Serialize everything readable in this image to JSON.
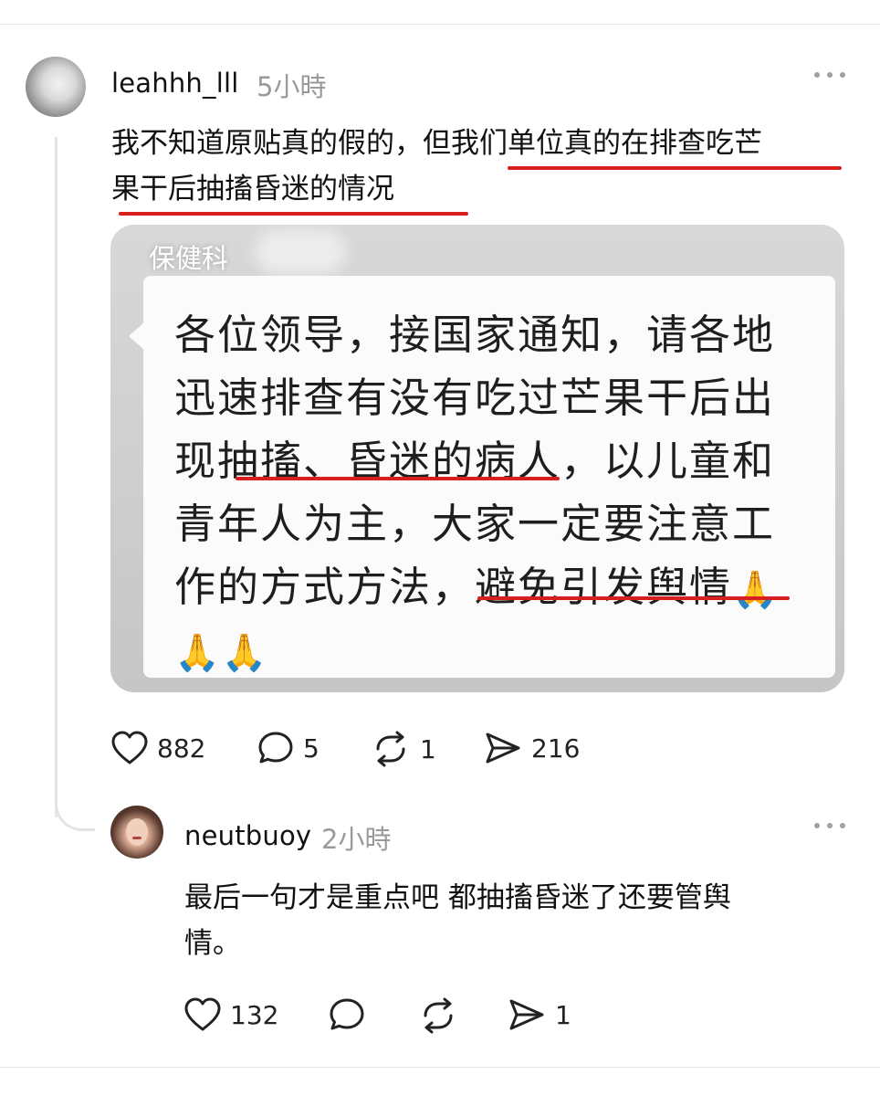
{
  "post": {
    "username": "leahhh_lll",
    "time": "5小時",
    "text_line1": "我不知道原贴真的假的，但我们单位真的在排查吃芒",
    "text_line2": "果干后抽搐昏迷的情况",
    "image": {
      "sender": "保健科",
      "message_lines": [
        "各位领导，接国家通知，请各地",
        "迅速排查有没有吃过芒果干后出",
        "现抽搐、昏迷的病人，以儿童和",
        "青年人为主，大家一定要注意工",
        "作的方式方法，避免引发舆情"
      ],
      "emoji": "🙏"
    },
    "likes": "882",
    "comments": "5",
    "reposts": "1",
    "shares": "216"
  },
  "reply": {
    "username": "neutbuoy",
    "time": "2小時",
    "text_line1": "最后一句才是重点吧 都抽搐昏迷了还要管舆",
    "text_line2": "情。",
    "likes": "132",
    "reposts": "",
    "shares": "1"
  },
  "icons": {
    "like": "heart-icon",
    "comment": "comment-bubble-icon",
    "repost": "repost-icon",
    "share": "send-icon",
    "more": "more-options-icon"
  },
  "colors": {
    "underline": "#d81e1e",
    "muted": "#9a9a9a"
  }
}
